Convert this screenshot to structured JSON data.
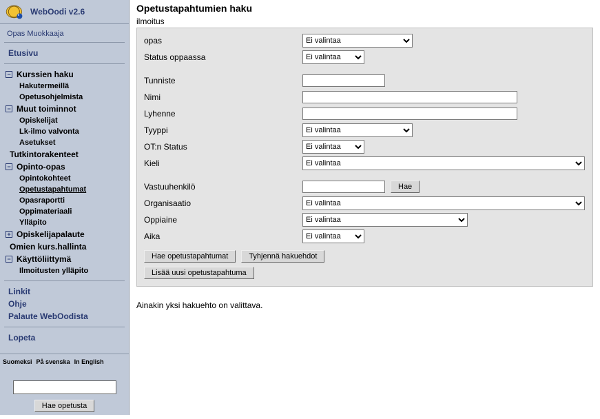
{
  "brand": {
    "title": "WebOodi v2.6"
  },
  "user": {
    "name": "Opas Muokkaaja"
  },
  "nav": {
    "home": "Etusivu",
    "groups": [
      {
        "label": "Kurssien haku",
        "items": [
          "Hakutermeillä",
          "Opetusohjelmista"
        ]
      },
      {
        "label": "Muut toiminnot",
        "items": [
          "Opiskelijat",
          "Lk-ilmo valvonta",
          "Asetukset"
        ]
      }
    ],
    "tutkintorakenteet": "Tutkintorakenteet",
    "opinto": {
      "label": "Opinto-opas",
      "items": [
        "Opintokohteet",
        "Opetustapahtumat",
        "Opasraportti",
        "Oppimateriaali",
        "Ylläpito"
      ]
    },
    "opiskelijapalaute": "Opiskelijapalaute",
    "omien": "Omien kurs.hallinta",
    "kayttoliittyma": {
      "label": "Käyttöliittymä",
      "items": [
        "Ilmoitusten ylläpito"
      ]
    },
    "linkit": "Linkit",
    "ohje": "Ohje",
    "palaute": "Palaute WebOodista",
    "lopeta": "Lopeta"
  },
  "lang": {
    "fi": "Suomeksi",
    "sv": "På svenska",
    "en": "In English"
  },
  "sidebarSearch": {
    "value": "",
    "button": "Hae opetusta"
  },
  "page": {
    "title": "Opetustapahtumien haku",
    "ilmoitus": "ilmoitus",
    "labels": {
      "opas": "opas",
      "statusOppaassa": "Status oppaassa",
      "tunniste": "Tunniste",
      "nimi": "Nimi",
      "lyhenne": "Lyhenne",
      "tyyppi": "Tyyppi",
      "otStatus": "OT:n Status",
      "kieli": "Kieli",
      "vastuuhenkilo": "Vastuuhenkilö",
      "organisaatio": "Organisaatio",
      "oppiaine": "Oppiaine",
      "aika": "Aika"
    },
    "selects": {
      "opas": "Ei valintaa",
      "statusOppaassa": "Ei valintaa",
      "tyyppi": "Ei valintaa",
      "otStatus": "Ei valintaa",
      "kieli": "Ei valintaa",
      "organisaatio": "Ei valintaa",
      "oppiaine": "Ei valintaa",
      "aika": "Ei valintaa"
    },
    "inputs": {
      "tunniste": "",
      "nimi": "",
      "lyhenne": "",
      "vastuuhenkilo": ""
    },
    "buttons": {
      "hae": "Hae",
      "haeOpetus": "Hae opetustapahtumat",
      "tyhjenna": "Tyhjennä hakuehdot",
      "lisaa": "Lisää uusi opetustapahtuma"
    },
    "message": "Ainakin yksi hakuehto on valittava."
  }
}
